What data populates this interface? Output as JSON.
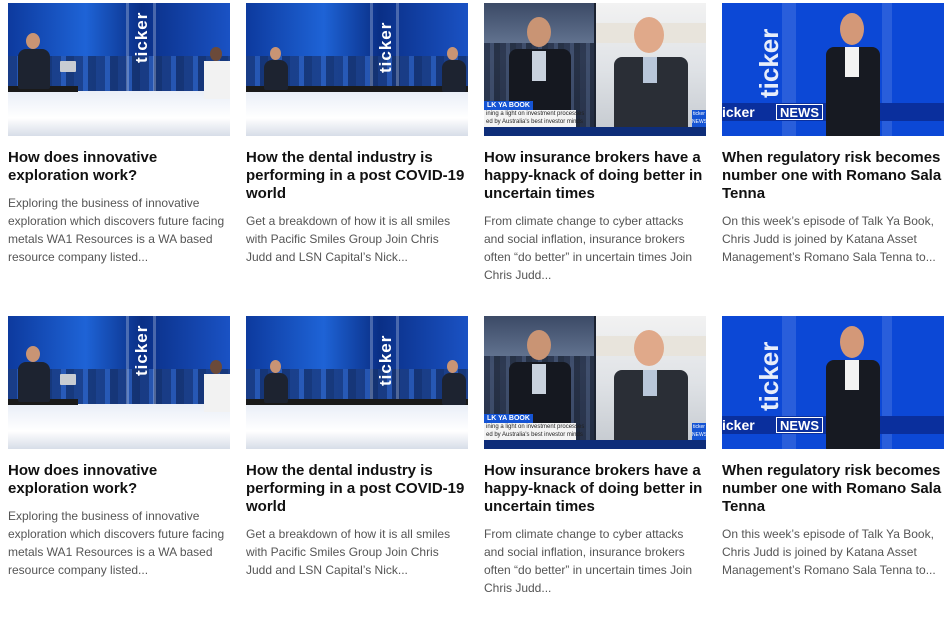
{
  "cards": [
    {
      "title": "How does innovative exploration work?",
      "description": "Exploring the business of innovative exploration which discovers future facing metals WA1 Resources is a WA based resource company listed...",
      "thumb_type": "studio",
      "thumb_logo": "ticker",
      "thumb_variant": "a"
    },
    {
      "title": "How the dental industry is performing in a post COVID-19 world",
      "description": "Get a breakdown of how it is all smiles with Pacific Smiles Group Join Chris Judd and LSN Capital’s Nick...",
      "thumb_type": "studio",
      "thumb_logo": "ticker",
      "thumb_variant": "b"
    },
    {
      "title": "How insurance brokers have a happy-knack of doing better in uncertain times",
      "description": "From climate change to cyber attacks and social inflation, insurance brokers often “do better” in uncertain times Join Chris Judd...",
      "thumb_type": "split",
      "thumb_tag": "LK YA BOOK",
      "thumb_line1": "ining a light on investment processes",
      "thumb_line2": "ed by Australia's best investor minds",
      "thumb_badge": "ticker NEWS"
    },
    {
      "title": "When regulatory risk becomes number one with Romano Sala Tenna",
      "description": "On this week’s episode of Talk Ya Book, Chris Judd is joined by Katana Asset Management’s Romano Sala Tenna to...",
      "thumb_type": "news",
      "thumb_logo": "icker",
      "thumb_news": "NEWS",
      "thumb_vertical": "ticker"
    },
    {
      "title": "How does innovative exploration work?",
      "description": "Exploring the business of innovative exploration which discovers future facing metals WA1 Resources is a WA based resource company listed...",
      "thumb_type": "studio",
      "thumb_logo": "ticker",
      "thumb_variant": "a"
    },
    {
      "title": "How the dental industry is performing in a post COVID-19 world",
      "description": "Get a breakdown of how it is all smiles with Pacific Smiles Group Join Chris Judd and LSN Capital’s Nick...",
      "thumb_type": "studio",
      "thumb_logo": "ticker",
      "thumb_variant": "b"
    },
    {
      "title": "How insurance brokers have a happy-knack of doing better in uncertain times",
      "description": "From climate change to cyber attacks and social inflation, insurance brokers often “do better” in uncertain times Join Chris Judd...",
      "thumb_type": "split",
      "thumb_tag": "LK YA BOOK",
      "thumb_line1": "ining a light on investment processes",
      "thumb_line2": "ed by Australia's best investor minds",
      "thumb_badge": "ticker NEWS"
    },
    {
      "title": "When regulatory risk becomes number one with Romano Sala Tenna",
      "description": "On this week’s episode of Talk Ya Book, Chris Judd is joined by Katana Asset Management’s Romano Sala Tenna to...",
      "thumb_type": "news",
      "thumb_logo": "icker",
      "thumb_news": "NEWS",
      "thumb_vertical": "ticker"
    }
  ],
  "colors": {
    "title": "#111111",
    "description": "#555555",
    "brand_blue": "#0c48d6"
  }
}
